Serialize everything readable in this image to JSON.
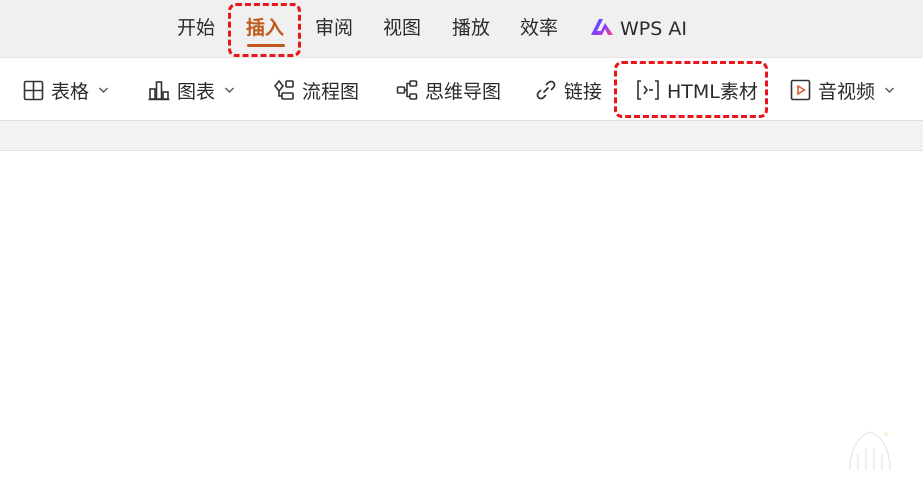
{
  "menu": {
    "tabs": [
      {
        "label": "开始",
        "active": false
      },
      {
        "label": "插入",
        "active": true
      },
      {
        "label": "审阅",
        "active": false
      },
      {
        "label": "视图",
        "active": false
      },
      {
        "label": "播放",
        "active": false
      },
      {
        "label": "效率",
        "active": false
      }
    ],
    "wps_ai": {
      "label": "WPS AI",
      "icon": "wps-ai-logo-icon"
    }
  },
  "toolbar": {
    "items": [
      {
        "label": "表格",
        "icon": "table-grid-icon",
        "has_dropdown": true
      },
      {
        "label": "图表",
        "icon": "bar-chart-icon",
        "has_dropdown": true
      },
      {
        "label": "流程图",
        "icon": "flowchart-icon",
        "has_dropdown": false
      },
      {
        "label": "思维导图",
        "icon": "mindmap-icon",
        "has_dropdown": false
      },
      {
        "label": "链接",
        "icon": "link-icon",
        "has_dropdown": false
      },
      {
        "label": "HTML素材",
        "icon": "html-code-icon",
        "has_dropdown": false
      },
      {
        "label": "音视频",
        "icon": "play-media-icon",
        "has_dropdown": true
      }
    ]
  },
  "colors": {
    "active_tab": "#c2571a",
    "highlight": "#e8161b",
    "menubar_bg": "#f0f0f1",
    "text": "#2b2b2b"
  },
  "highlights": [
    "插入",
    "HTML素材"
  ]
}
